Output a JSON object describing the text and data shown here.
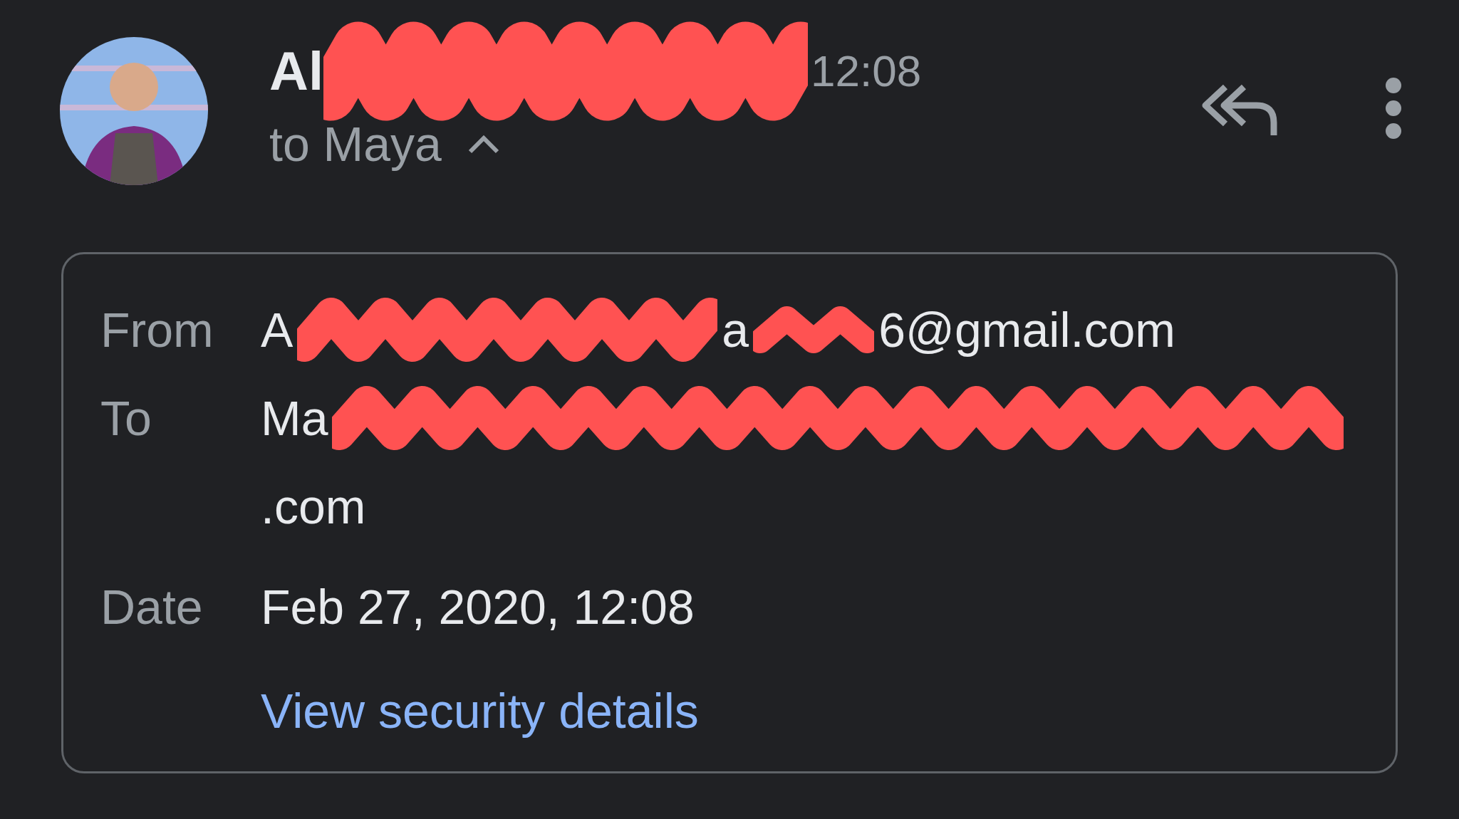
{
  "header": {
    "sender_visible": "Al",
    "time": "12:08",
    "recipient_line": "to Maya",
    "expanded": true
  },
  "details": {
    "rows": [
      {
        "label": "From",
        "parts": [
          {
            "kind": "text",
            "text": "A"
          },
          {
            "kind": "redacted"
          },
          {
            "kind": "text",
            "text": "a"
          },
          {
            "kind": "redacted"
          },
          {
            "kind": "text",
            "text": "6@gmail.com"
          }
        ]
      },
      {
        "label": "To",
        "parts": [
          {
            "kind": "text",
            "text": "Ma"
          },
          {
            "kind": "redacted"
          }
        ]
      },
      {
        "label": "",
        "parts": [
          {
            "kind": "text",
            "text": ".com"
          }
        ]
      },
      {
        "label": "Date",
        "parts": [
          {
            "kind": "text",
            "text": "Feb 27, 2020, 12:08"
          }
        ]
      }
    ],
    "link": "View security details"
  }
}
